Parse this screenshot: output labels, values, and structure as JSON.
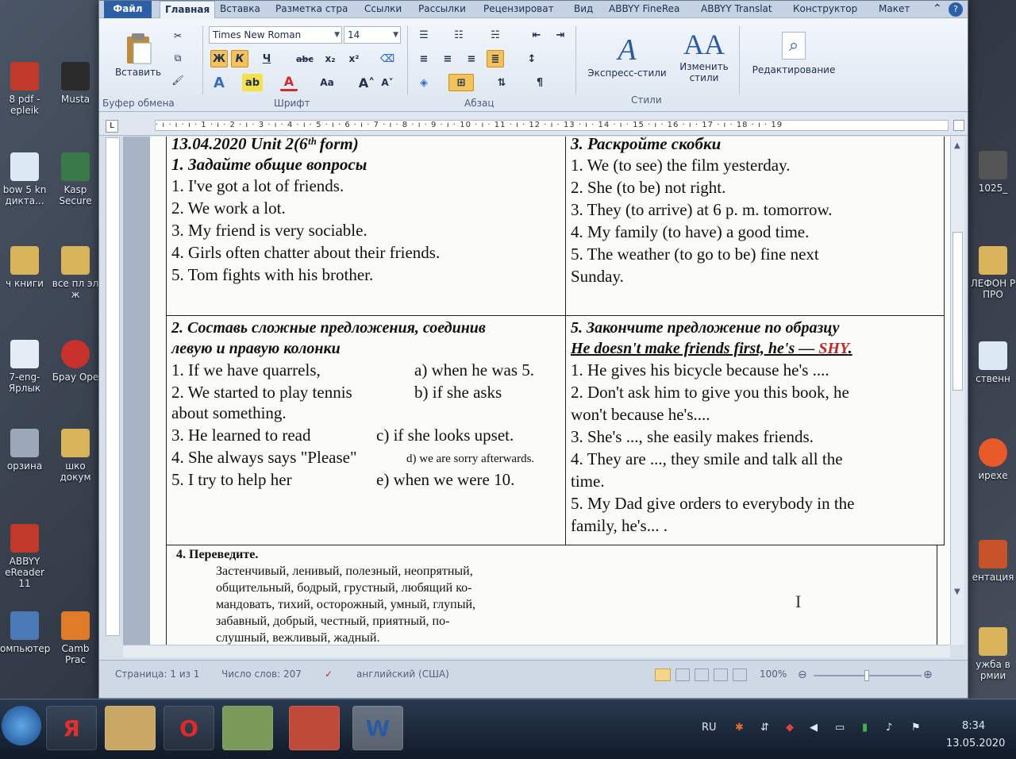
{
  "desktop": {
    "icons": [
      {
        "label": "8 pdf - epleik"
      },
      {
        "label": "Musta"
      },
      {
        "label": "bow 5 kn дикта..."
      },
      {
        "label": "Kasp Secure"
      },
      {
        "label": "ч книги"
      },
      {
        "label": "все пл эл ж"
      },
      {
        "label": "7-eng- Ярлык"
      },
      {
        "label": "Брау Ope"
      },
      {
        "label": "орзина"
      },
      {
        "label": "шко докум"
      },
      {
        "label": "ABBYY eReader 11"
      },
      {
        "label": "омпьютер"
      },
      {
        "label": "Camb Prac"
      }
    ],
    "right_icons": [
      {
        "label": "1025_"
      },
      {
        "label": "ЛЕФОН P ПРО"
      },
      {
        "label": "ственн"
      },
      {
        "label": "ирехе"
      },
      {
        "label": "ентация"
      },
      {
        "label": "ужба в рмии"
      }
    ]
  },
  "ribbon": {
    "tabs": [
      "Файл",
      "Главная",
      "Вставка",
      "Разметка стра",
      "Ссылки",
      "Рассылки",
      "Рецензироват",
      "Вид",
      "ABBYY FineRea",
      "ABBYY Translat",
      "Конструктор",
      "Макет"
    ],
    "paste_label": "Вставить",
    "clipboard_label": "Буфер обмена",
    "font_name": "Times New Roman",
    "font_size": "14",
    "font_group_label": "Шрифт",
    "paragraph_label": "Абзац",
    "express_styles_label": "Экспресс-стили",
    "change_styles_label": "Изменить стили",
    "styles_label": "Стили",
    "editing_label": "Редактирование",
    "format_buttons": [
      "Ж",
      "К",
      "Ч",
      "abc",
      "x₂",
      "x²"
    ]
  },
  "ruler": {
    "marks": "· ı · ı · ı · 1 · ı · 2 · ı · 3 · ı · 4 · ı · 5 · ı · 6 · ı · 7 · ı · 8 · ı · 9 · ı · 10 · ı · 11 · ı · 12 · ı · 13 · ı · 14 · ı · 15 · ı · 16 · ı · 17 · ı · 18 · ı · 19"
  },
  "document": {
    "cell1": {
      "header_line": "13.04.2020      Unit 2(6ᵗʰ form)",
      "title": "1. Задайте общие вопросы",
      "lines": [
        "1. I've got a lot of friends.",
        "2. We work a lot.",
        "3. My friend is very sociable.",
        "4. Girls often chatter about their friends.",
        "5. Tom fights with his brother."
      ]
    },
    "cell2": {
      "title": "3. Раскройте скобки",
      "lines": [
        "1. We (to see) the film yesterday.",
        "2.  She (to be) not right.",
        "3. They (to arrive) at 6 p. m. tomorrow.",
        "4.  My family (to have) a good time.",
        "5.  The  weather  (to  go  to  be)  fine  next",
        "Sunday."
      ]
    },
    "cell3": {
      "title1": "2. Составь сложные предложения, соединив",
      "title2": "левую и правую колонки",
      "left": [
        "1. If we have quarrels,",
        "2. We started to play tennis",
        "about something.",
        "3. He learned to read",
        "4. She always says \"Please\"",
        "5. I try to help her"
      ],
      "right": [
        "a) when he was 5.",
        "b)   if   she   asks",
        "",
        "c) if she looks upset.",
        "d) we are sorry afterwards.",
        "e) when we were 10."
      ]
    },
    "cell4": {
      "title": "5. Закончите предложение по образцу",
      "example_prefix": "He doesn't make friends first, he's — ",
      "example_word": "SHY",
      "lines": [
        "1.  He gives his bicycle because he's ....",
        "2.  Don't ask him to give you this book, he",
        "won't because he's....",
        "3. She's ..., she easily makes friends.",
        "4.  They  are  ...,  they  smile  and  talk  all  the",
        "time.",
        "5. My Dad give orders to everybody in the",
        "family, he's... ."
      ]
    },
    "cell5": {
      "title": "4. Переведите.",
      "lines": [
        "Застенчивый, ленивый, полезный, неопрятный,",
        "общительный, бодрый, грустный, любящий ко-",
        "мандовать, тихий, осторожный, умный, глупый,",
        "забавный, добрый, честный, приятный, по-",
        "слушный, вежливый, жадный."
      ]
    }
  },
  "status": {
    "page": "Страница: 1 из 1",
    "words": "Число слов: 207",
    "lang": "английский (США)",
    "zoom": "100%"
  },
  "taskbar": {
    "lang": "RU",
    "time": "8:34",
    "date": "13.05.2020"
  }
}
